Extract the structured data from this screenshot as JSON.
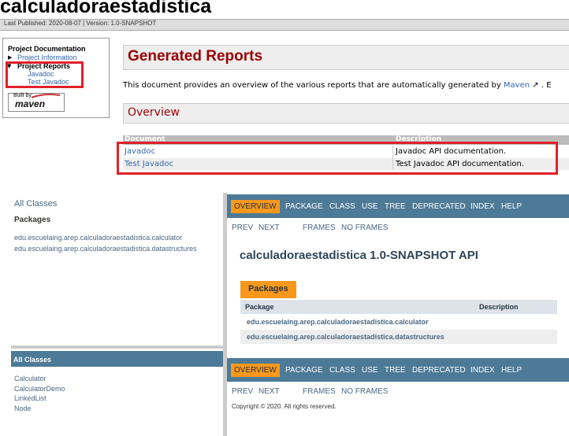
{
  "site": {
    "title": "calculadoraestadistica",
    "published": "Last Published: 2020-08-07  |  Version: 1.0-SNAPSHOT"
  },
  "nav": {
    "heading": "Project Documentation",
    "project_information": "Project Information",
    "project_reports": "Project Reports",
    "javadoc": "Javadoc",
    "test_javadoc": "Test Javadoc",
    "built_by": "Built by:",
    "maven_logo": "maven"
  },
  "main": {
    "title": "Generated Reports",
    "intro_prefix": "This document provides an overview of the various reports that are automatically generated by ",
    "intro_link": "Maven",
    "intro_suffix": " ↗ . E",
    "overview_title": "Overview",
    "table": {
      "headers": [
        "Document",
        "Description"
      ],
      "rows": [
        [
          "Javadoc",
          "Javadoc API documentation."
        ],
        [
          "Test Javadoc",
          "Test Javadoc API documentation."
        ]
      ]
    }
  },
  "javadoc": {
    "all_classes_link": "All Classes",
    "packages_label": "Packages",
    "packages": [
      "edu.escuelaing.arep.calculadoraestadistica.calculator",
      "edu.escuelaing.arep.calculadoraestadistica.datastructures"
    ],
    "all_classes_title": "All Classes",
    "classes": [
      "Calculator",
      "CalculatorDemo",
      "LinkedList",
      "Node"
    ],
    "navbar": [
      "OVERVIEW",
      "PACKAGE",
      "CLASS",
      "USE",
      "TREE",
      "DEPRECATED",
      "INDEX",
      "HELP"
    ],
    "subnav": [
      "PREV",
      "NEXT",
      "FRAMES",
      "NO FRAMES"
    ],
    "api_title": "calculadoraestadistica 1.0-SNAPSHOT API",
    "packages_tab": "Packages",
    "pkg_table_headers": [
      "Package",
      "Description"
    ],
    "copyright": "Copyright © 2020. All rights reserved."
  },
  "colors": {
    "accent_red": "#e0202a",
    "javadoc_nav": "#4d7a97",
    "javadoc_active": "#f8981d",
    "report_title": "#990000"
  }
}
